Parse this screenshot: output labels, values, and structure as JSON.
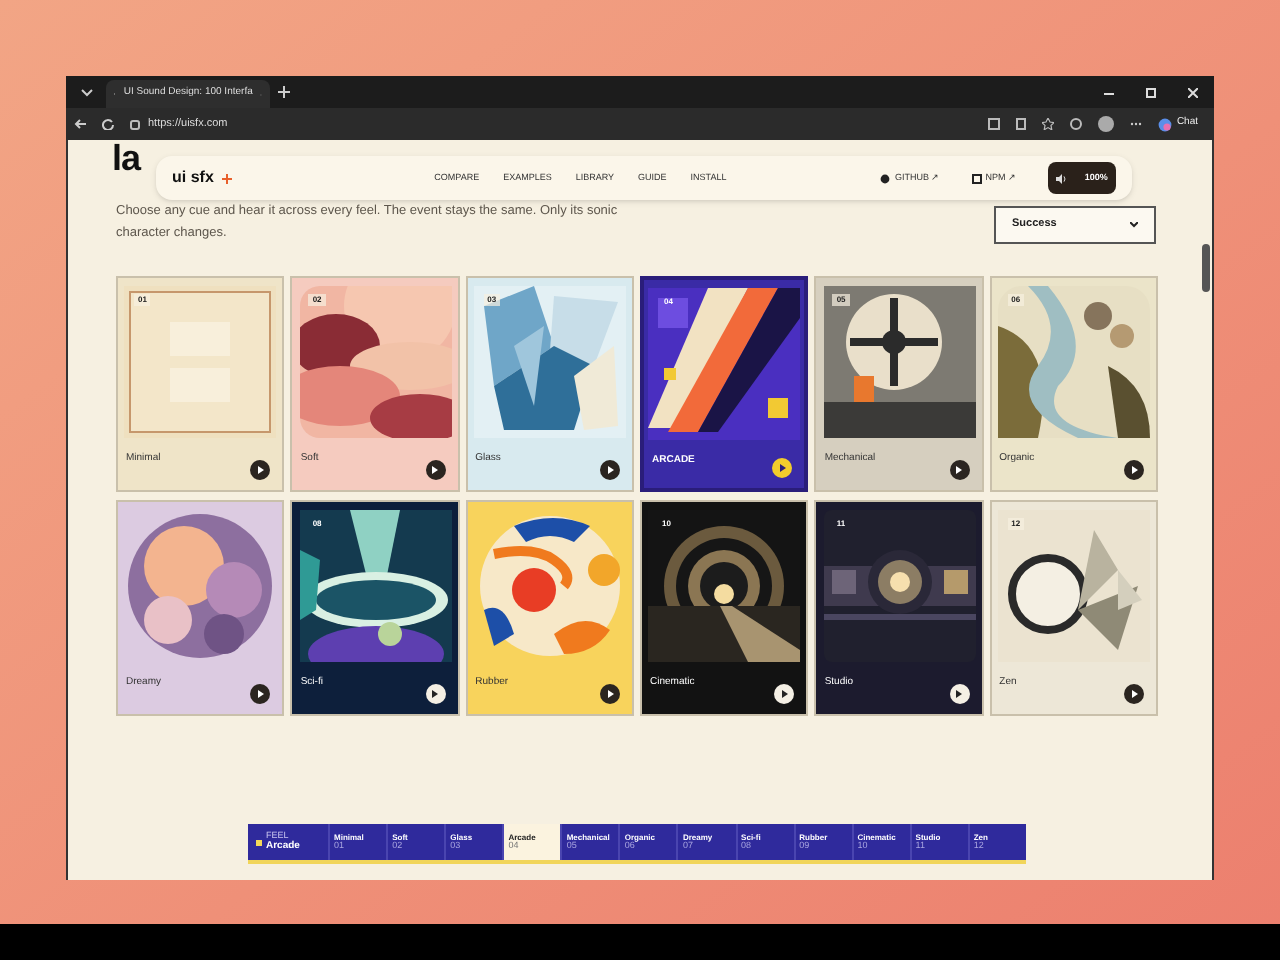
{
  "browser": {
    "tab_title": "UI Sound Design: 100 Interfa",
    "address": "https://uisfx.com",
    "profile_button": "Chat"
  },
  "heading": "la",
  "nav": {
    "logo": "ui sfx",
    "links": [
      "COMPARE",
      "EXAMPLES",
      "LIBRARY",
      "GUIDE",
      "INSTALL"
    ],
    "github": "GITHUB ↗",
    "npm": "NPM ↗",
    "volume": "100%"
  },
  "intro": "Choose any cue and hear it across every feel. The event stays the same. Only its sonic character changes.",
  "cue_select": {
    "value": "Success"
  },
  "cards": [
    {
      "number": "01",
      "label": "Minimal",
      "selected": false,
      "color": "#efe4c8"
    },
    {
      "number": "02",
      "label": "Soft",
      "selected": false,
      "color": "#f5cbbf"
    },
    {
      "number": "03",
      "label": "Glass",
      "selected": false,
      "color": "#d8eaef"
    },
    {
      "number": "04",
      "label": "ARCADE",
      "selected": true,
      "color": "#3a2ba6"
    },
    {
      "number": "05",
      "label": "Mechanical",
      "selected": false,
      "color": "#d6cfbf"
    },
    {
      "number": "06",
      "label": "Organic",
      "selected": false,
      "color": "#ebe4c9"
    },
    {
      "label": "Dreamy",
      "selected": false,
      "color": "#dccbe1"
    },
    {
      "number": "08",
      "label": "Sci-fi",
      "selected": false,
      "color": "#0d1f3b"
    },
    {
      "label": "Rubber",
      "selected": false,
      "color": "#f8d35c"
    },
    {
      "number": "10",
      "label": "Cinematic",
      "selected": false,
      "color": "#121212"
    },
    {
      "number": "11",
      "label": "Studio",
      "selected": false,
      "color": "#1c1b2e"
    },
    {
      "number": "12",
      "label": "Zen",
      "selected": false,
      "color": "#ede7d7"
    }
  ],
  "feel_bar": {
    "caption": "FEEL",
    "current": "Arcade",
    "items": [
      {
        "label": "Minimal",
        "number": "01",
        "selected": false
      },
      {
        "label": "Soft",
        "number": "02",
        "selected": false
      },
      {
        "label": "Glass",
        "number": "03",
        "selected": false
      },
      {
        "label": "Arcade",
        "number": "04",
        "selected": true
      },
      {
        "label": "Mechanical",
        "number": "05",
        "selected": false
      },
      {
        "label": "Organic",
        "number": "06",
        "selected": false
      },
      {
        "label": "Dreamy",
        "number": "07",
        "selected": false
      },
      {
        "label": "Sci-fi",
        "number": "08",
        "selected": false
      },
      {
        "label": "Rubber",
        "number": "09",
        "selected": false
      },
      {
        "label": "Cinematic",
        "number": "10",
        "selected": false
      },
      {
        "label": "Studio",
        "number": "11",
        "selected": false
      },
      {
        "label": "Zen",
        "number": "12",
        "selected": false
      }
    ]
  }
}
